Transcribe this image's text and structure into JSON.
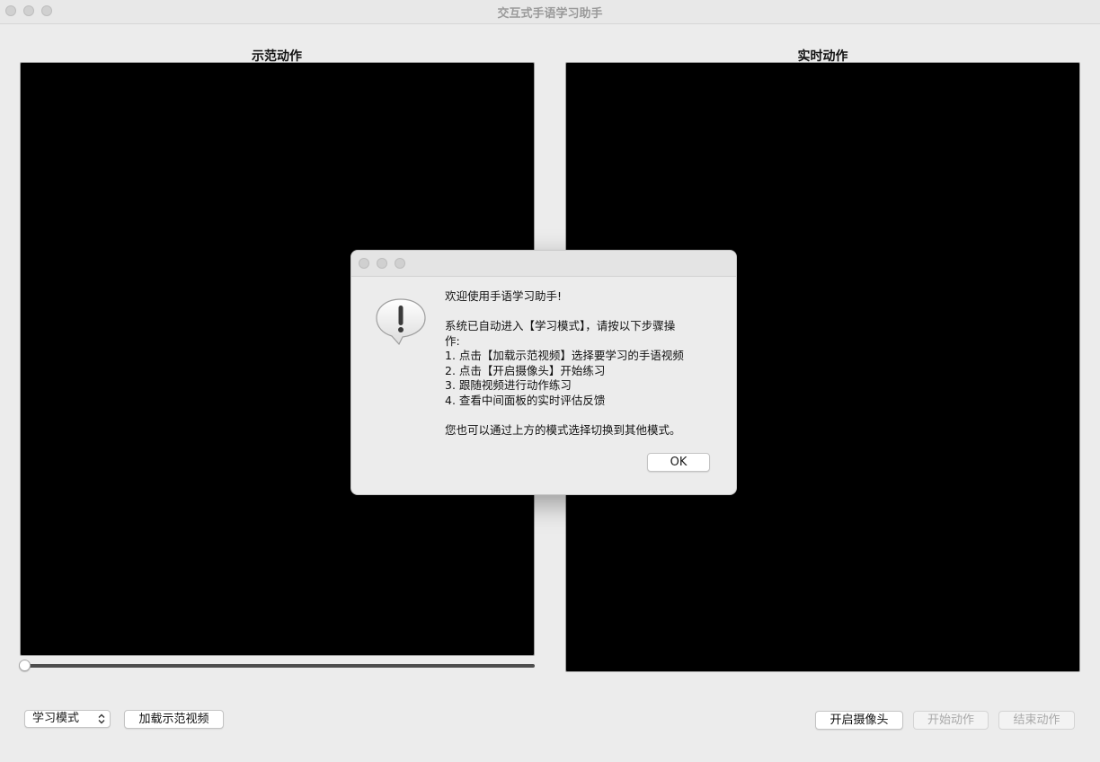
{
  "window": {
    "title": "交互式手语学习助手"
  },
  "panels": {
    "demo_label": "示范动作",
    "live_label": "实时动作"
  },
  "controls": {
    "mode_select_value": "学习模式",
    "load_demo_video": "加载示范视频",
    "open_camera": "开启摄像头",
    "start_action": "开始动作",
    "end_action": "结束动作"
  },
  "playback": {
    "progress": 0
  },
  "dialog": {
    "lines": [
      "欢迎使用手语学习助手!",
      "",
      "系统已自动进入【学习模式】，请按以下步骤操",
      "作:",
      "1. 点击【加载示范视频】选择要学习的手语视频",
      "2. 点击【开启摄像头】开始练习",
      "3. 跟随视频进行动作练习",
      "4. 查看中间面板的实时评估反馈",
      "",
      "您也可以通过上方的模式选择切换到其他模式。"
    ],
    "ok_label": "OK",
    "icon": "warning-exclamation-icon"
  },
  "colors": {
    "window_bg": "#ececec",
    "video_bg": "#000000",
    "disabled_text": "#a9a9a9"
  }
}
